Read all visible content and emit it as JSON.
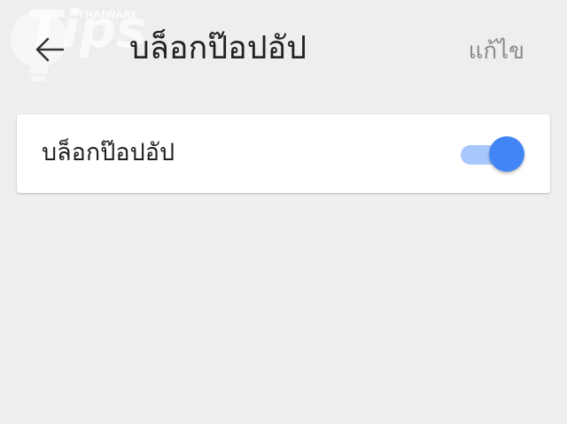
{
  "header": {
    "back_icon": "arrow-back-icon",
    "title": "บล็อกป๊อปอัป",
    "edit_label": "แก้ไข"
  },
  "setting": {
    "label": "บล็อกป๊อปอัป",
    "toggle": {
      "on": true,
      "track_color": "#a8c7fa",
      "thumb_color": "#4285f4"
    }
  },
  "watermark": {
    "brand": "Tips",
    "sub": "THAIWARE",
    "icon": "lightbulb-icon"
  },
  "colors": {
    "background": "#eeeeee",
    "card": "#ffffff",
    "title_text": "#202124",
    "edit_text": "#8a8a8a"
  }
}
